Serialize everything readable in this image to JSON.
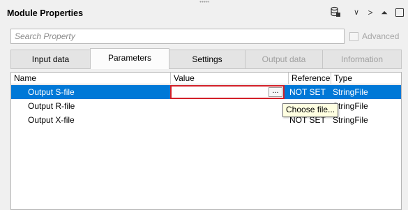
{
  "panel": {
    "title": "Module Properties"
  },
  "header_icons": [
    "database-icon",
    "chevron-down-icon",
    "chevron-right-icon",
    "pin-icon",
    "window-icon"
  ],
  "search": {
    "placeholder": "Search Property",
    "value": ""
  },
  "advanced": {
    "label": "Advanced",
    "checked": false
  },
  "tabs": [
    {
      "label": "Input data",
      "active": false,
      "enabled": true
    },
    {
      "label": "Parameters",
      "active": true,
      "enabled": true
    },
    {
      "label": "Settings",
      "active": false,
      "enabled": true
    },
    {
      "label": "Output data",
      "active": false,
      "enabled": false
    },
    {
      "label": "Information",
      "active": false,
      "enabled": false
    }
  ],
  "grid": {
    "columns": [
      "Name",
      "Value",
      "Reference",
      "Type"
    ],
    "rows": [
      {
        "name": "Output S-file",
        "value": "",
        "reference": "NOT SET",
        "type": "StringFile",
        "selected": true
      },
      {
        "name": "Output R-file",
        "value": "",
        "reference": "",
        "type": "StringFile",
        "selected": false
      },
      {
        "name": "Output X-file",
        "value": "",
        "reference": "NOT SET",
        "type": "StringFile",
        "selected": false
      }
    ],
    "editor_button": "..."
  },
  "tooltip": "Choose file...",
  "colors": {
    "selection": "#0078d7",
    "highlight_border": "#d32029",
    "tooltip_bg": "#ffffe1"
  }
}
